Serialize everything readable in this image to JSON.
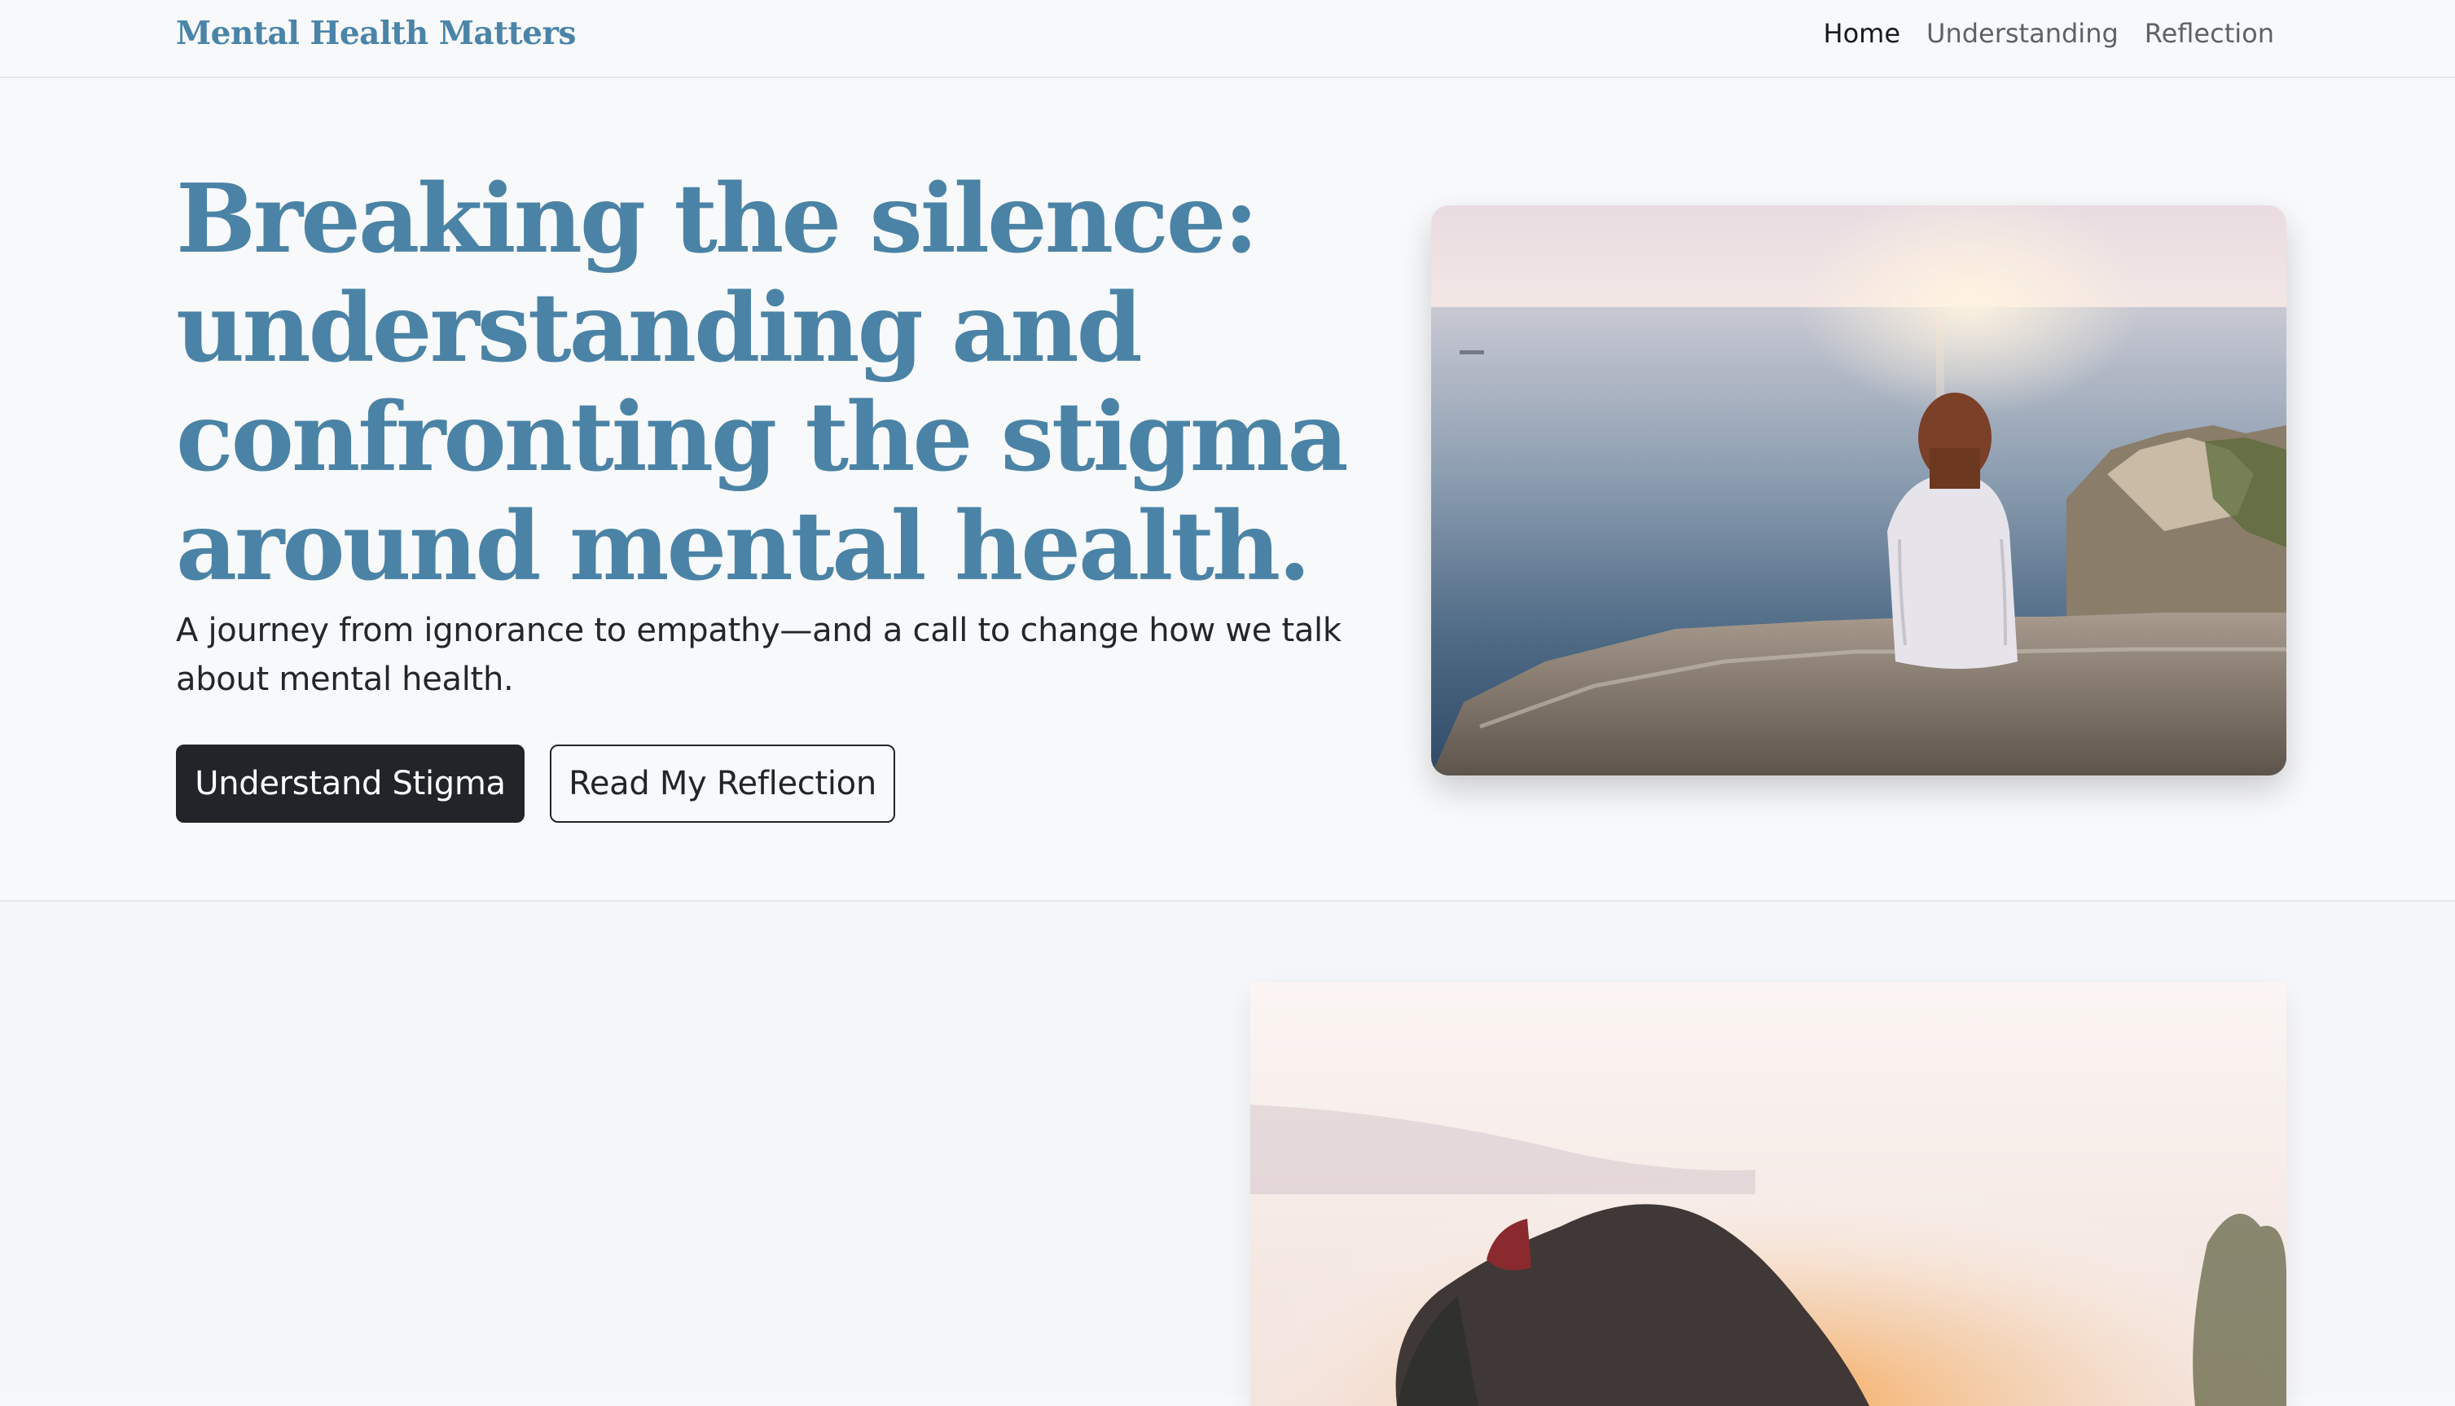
{
  "navbar": {
    "brand": "Mental Health Matters",
    "links": [
      {
        "label": "Home",
        "active": true
      },
      {
        "label": "Understanding",
        "active": false
      },
      {
        "label": "Reflection",
        "active": false
      }
    ]
  },
  "hero": {
    "title": "Breaking the silence: understanding and confronting the stigma around mental health.",
    "subtitle": "A journey from ignorance to empathy—and a call to change how we talk about mental health.",
    "primary_button": "Understand Stigma",
    "secondary_button": "Read My Reflection"
  },
  "colors": {
    "brand_blue": "#4a83a6",
    "button_dark": "#212529",
    "background": "#f8f9fb"
  }
}
